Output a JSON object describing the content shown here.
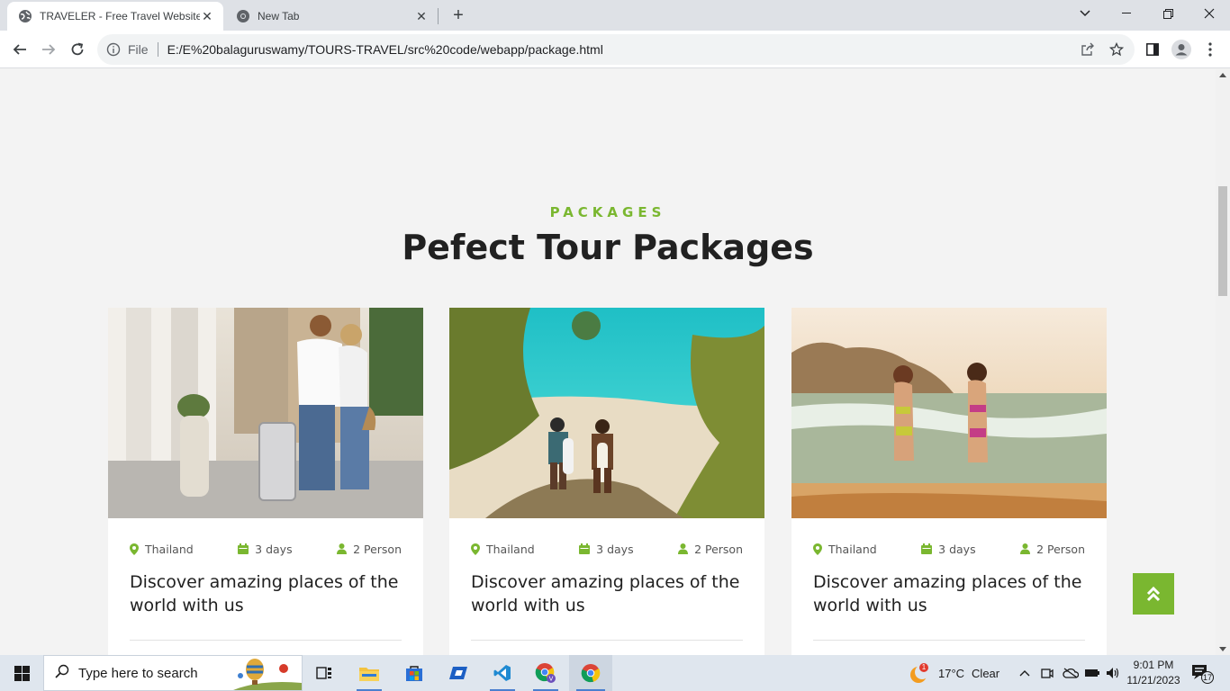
{
  "browser": {
    "tabs": [
      {
        "title": "TRAVELER - Free Travel Website",
        "active": true
      },
      {
        "title": "New Tab",
        "active": false
      }
    ],
    "new_tab_label": "+",
    "omnibox": {
      "scheme": "File",
      "url": "E:/E%20balaguruswamy/TOURS-TRAVEL/src%20code/webapp/package.html"
    }
  },
  "page": {
    "eyebrow": "PACKAGES",
    "title": "Pefect Tour Packages",
    "accent_color": "#7ab730",
    "cards": [
      {
        "location": "Thailand",
        "duration": "3 days",
        "people": "2 Person",
        "headline": "Discover amazing places of the world with us",
        "photo": "couple-with-suitcase-city-street"
      },
      {
        "location": "Thailand",
        "duration": "3 days",
        "people": "2 Person",
        "headline": "Discover amazing places of the world with us",
        "photo": "surfers-walking-to-beach"
      },
      {
        "location": "Thailand",
        "duration": "3 days",
        "people": "2 Person",
        "headline": "Discover amazing places of the world with us",
        "photo": "women-walking-into-sea"
      }
    ],
    "back_to_top_icon": "double-chevron-up-icon"
  },
  "taskbar": {
    "search_placeholder": "Type here to search",
    "weather": {
      "temp": "17°C",
      "condition": "Clear",
      "badge": "1"
    },
    "clock": {
      "time": "9:01 PM",
      "date": "11/21/2023"
    },
    "notifications": "17"
  }
}
